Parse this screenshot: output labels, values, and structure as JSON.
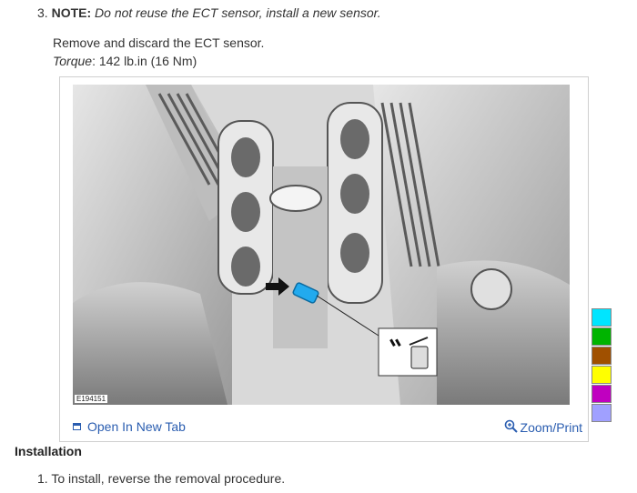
{
  "step3": {
    "number": "3.",
    "note_label": "NOTE:",
    "note_text": "Do not reuse the ECT sensor, install a new sensor."
  },
  "instruction": {
    "text": "Remove and discard the ECT sensor.",
    "torque_label": "Torque",
    "torque_value": ": 142 lb.in (16 Nm)"
  },
  "figure": {
    "id": "E194151",
    "open_tab_label": "Open In New Tab",
    "zoom_label": "Zoom/Print"
  },
  "installation": {
    "heading": "Installation",
    "step_number": "1.",
    "step_text": "To install, reverse the removal procedure."
  },
  "palette": {
    "colors": [
      "#00e5ff",
      "#00b400",
      "#a05000",
      "#ffff00",
      "#c000c0",
      "#a0a0ff"
    ]
  }
}
